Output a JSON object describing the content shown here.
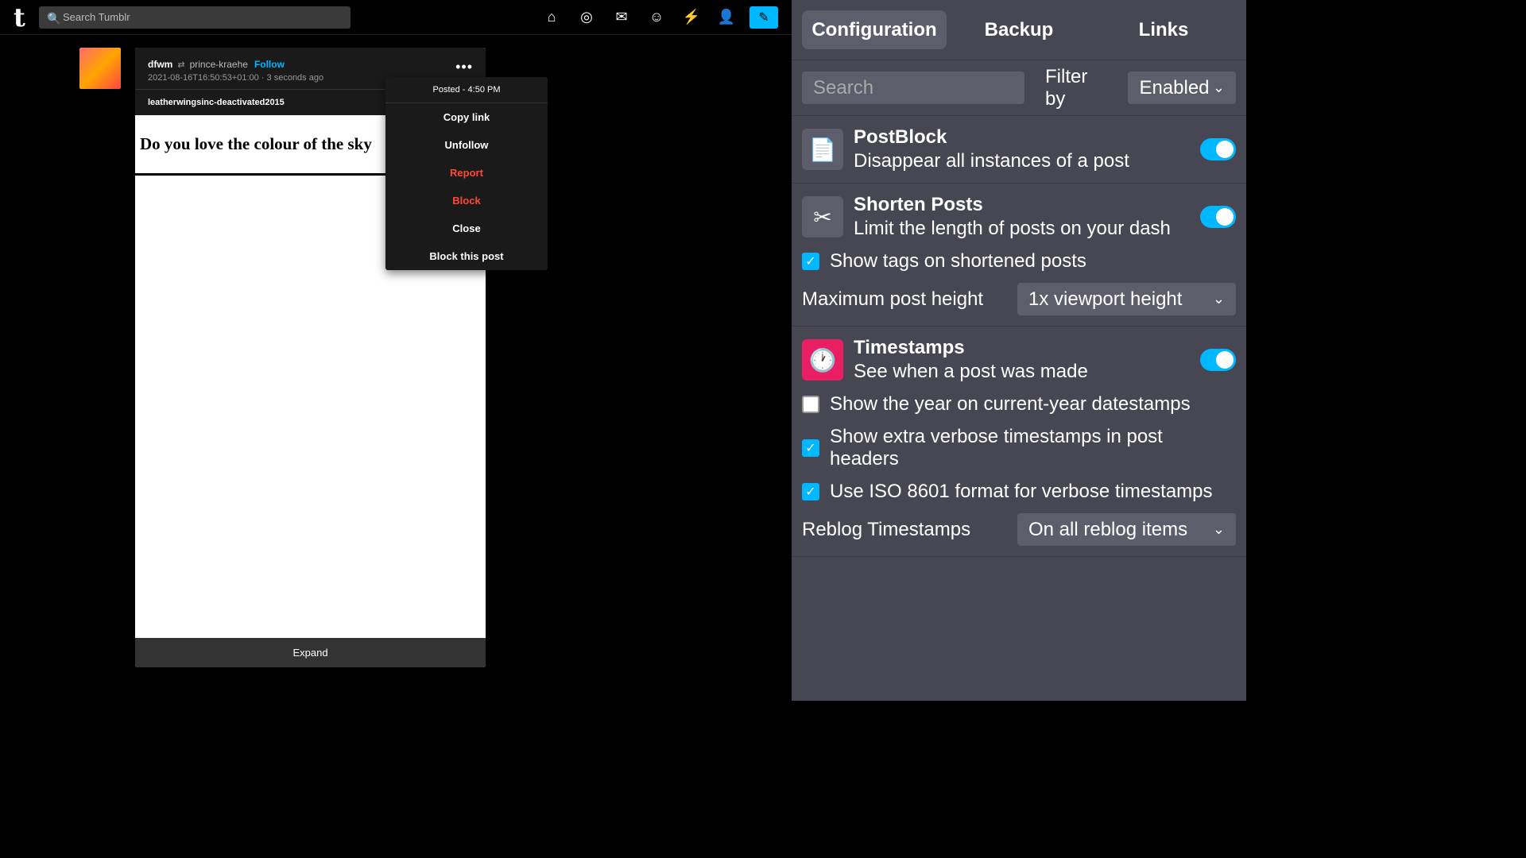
{
  "tumblr": {
    "logo": "t",
    "search": {
      "placeholder": "Search Tumblr"
    },
    "nav": {
      "home_icon": "⌂",
      "explore_icon": "◎",
      "inbox_icon": "✉",
      "emoji_icon": "☺",
      "activity_icon": "⚡",
      "account_icon": "👤",
      "compose_icon": "✎"
    },
    "post": {
      "username": "dfwm",
      "reblog_icon": "⇄",
      "reblogged_from": "prince-kraehe",
      "follow_label": "Follow",
      "timestamp": "2021-08-16T16:50:53+01:00 · 3 seconds ago",
      "more_icon": "•••",
      "reblog_username": "leatherwingsinc-deactivated2015",
      "content_text": "Do you love the colour of the sky",
      "expand_label": "Expand"
    },
    "context_menu": {
      "header": "Posted - 4:50 PM",
      "items": [
        {
          "label": "Copy link",
          "type": "normal"
        },
        {
          "label": "Unfollow",
          "type": "normal"
        },
        {
          "label": "Report",
          "type": "danger"
        },
        {
          "label": "Block",
          "type": "danger"
        },
        {
          "label": "Close",
          "type": "normal"
        },
        {
          "label": "Block this post",
          "type": "normal"
        }
      ]
    }
  },
  "extension": {
    "tabs": [
      {
        "label": "Configuration",
        "active": true
      },
      {
        "label": "Backup",
        "active": false
      },
      {
        "label": "Links",
        "active": false
      }
    ],
    "filter": {
      "search_placeholder": "Search",
      "filter_label": "Filter by",
      "filter_value": "Enabled"
    },
    "features": [
      {
        "title": "PostBlock",
        "description": "Disappear all instances of a post",
        "icon": "📄",
        "icon_color": "gray",
        "enabled": true
      },
      {
        "title": "Shorten Posts",
        "description": "Limit the length of posts on your dash",
        "icon": "✂",
        "icon_color": "gray",
        "enabled": true,
        "options": [
          {
            "type": "checkbox",
            "label": "Show tags on shortened posts",
            "checked": true
          },
          {
            "type": "select",
            "label": "Maximum post height",
            "value": "1x viewport height"
          }
        ]
      },
      {
        "title": "Timestamps",
        "description": "See when a post was made",
        "icon": "🕐",
        "icon_color": "pink",
        "enabled": true,
        "options": [
          {
            "type": "checkbox",
            "label": "Show the year on current-year datestamps",
            "checked": false
          },
          {
            "type": "checkbox",
            "label": "Show extra verbose timestamps in post headers",
            "checked": true
          },
          {
            "type": "checkbox",
            "label": "Use ISO 8601 format for verbose timestamps",
            "checked": true
          },
          {
            "type": "select",
            "label": "Reblog Timestamps",
            "value": "On all reblog items"
          }
        ]
      }
    ]
  }
}
